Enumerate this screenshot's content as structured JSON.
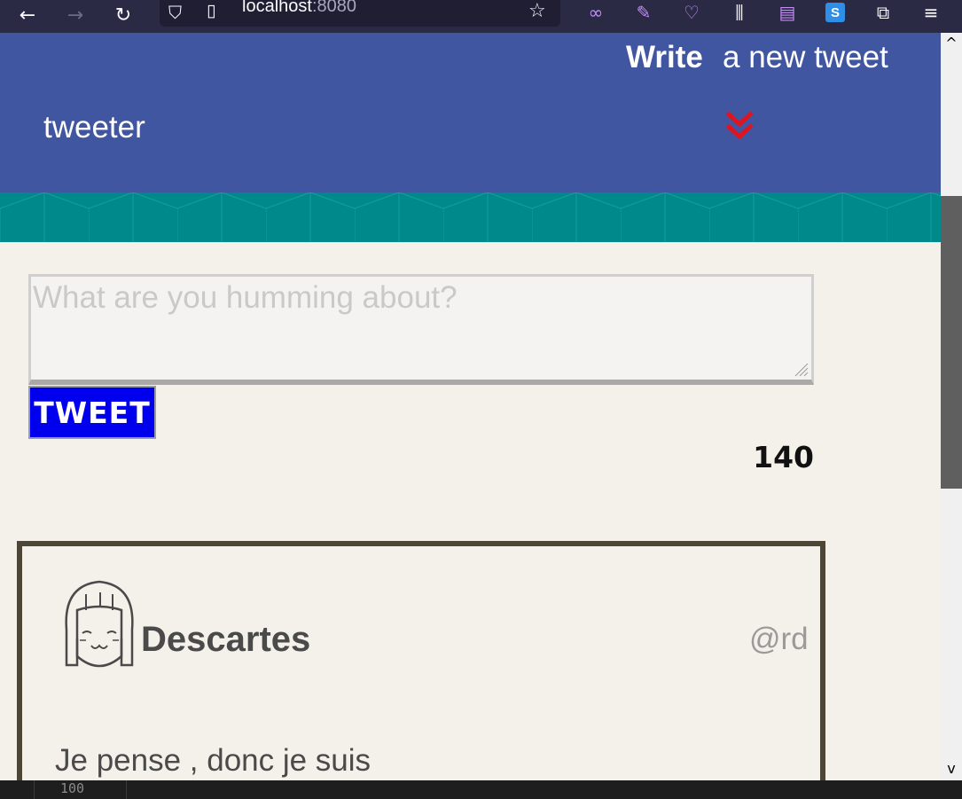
{
  "browser": {
    "url_host": "localhost",
    "url_port": ":8080",
    "back_icon": "arrow-left-icon",
    "forward_icon": "arrow-right-icon",
    "reload_icon": "reload-icon"
  },
  "header": {
    "write_label": "Write",
    "new_tweet_label": "a new tweet",
    "brand": "tweeter",
    "toggle_icon": "double-chevron-down-icon"
  },
  "compose": {
    "placeholder": "What are you humming about?",
    "tweet_button": "TWEET",
    "counter": "140"
  },
  "tweet": {
    "author_name": "Descartes",
    "author_handle": "@rd",
    "text": "Je pense , donc je suis"
  },
  "devtools": {
    "zoom": "100"
  },
  "colors": {
    "header_bg": "#4156a1",
    "strip_bg": "#00898a",
    "page_bg": "#f4f1ea",
    "tweet_button_bg": "#0000ee",
    "chevron": "#e0141f",
    "card_border": "#4d4637"
  }
}
